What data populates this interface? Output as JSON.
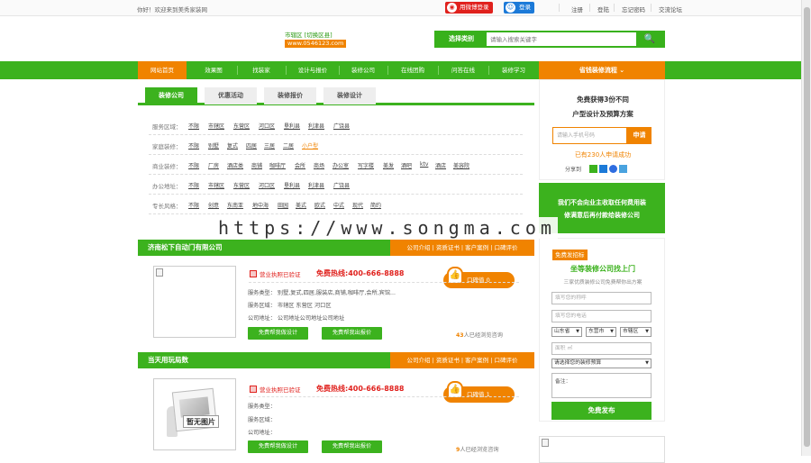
{
  "topbar": {
    "welcome": "你好！欢迎来到美秀家装网",
    "weibo_login": "用微博登录",
    "qq_login": "登录",
    "links": [
      "注册",
      "登陆",
      "忘记密码",
      "交流论坛"
    ]
  },
  "header": {
    "city": "市辖区 [切换区县]",
    "phone": "www.0546123.com",
    "search_category": "选择类别",
    "search_placeholder": "请输入搜索关键字"
  },
  "nav": {
    "items": [
      "网站首页",
      "效果图",
      "找装家",
      "设计与报价",
      "装修公司",
      "在线团购",
      "问答在线",
      "装修学习"
    ],
    "right": "省钱装修流程 ⌄"
  },
  "tabs": [
    "装修公司",
    "优惠活动",
    "装修报价",
    "装修设计"
  ],
  "filters": [
    {
      "label": "服务区域：",
      "options": [
        "不限",
        "市辖区",
        "东营区",
        "河口区",
        "垦利县",
        "利津县",
        "广饶县"
      ]
    },
    {
      "label": "家庭装修：",
      "options": [
        "不限",
        "别墅",
        "复式",
        "四居",
        "三居",
        "二居",
        "小户型"
      ]
    },
    {
      "label": "商业装修：",
      "options": [
        "不限",
        "厂房",
        "酒店类",
        "商铺",
        "咖啡厅",
        "会所",
        "商场",
        "办公室",
        "写字楼",
        "美发",
        "酒吧",
        "ktv",
        "酒店",
        "美容院"
      ]
    },
    {
      "label": "办公地址：",
      "options": [
        "不限",
        "市辖区",
        "东营区",
        "河口区",
        "垦利县",
        "利津县",
        "广饶县"
      ]
    },
    {
      "label": "专长风格：",
      "options": [
        "不限",
        "创意",
        "东南亚",
        "地中海",
        "田园",
        "美式",
        "欧式",
        "中式",
        "现代",
        "简约"
      ]
    }
  ],
  "watermark": "https://www.songma.com",
  "companies": [
    {
      "name": "济南松下自动门有限公司",
      "links": "公司介绍 | 资质证书 | 客户案例 | 口碑评价",
      "license": "营业执照已验证",
      "hotline": "免费热线:400-666-8888",
      "koubei": "口碑值 0",
      "type": "服务类型：  别墅,复式,四居,服装店,商铺,咖啡厅,会所,宾馆...",
      "area": "服务区域：  市辖区 东营区 河口区",
      "address": "公司地址：  公司地址公司地址公司地址",
      "btn_design": "免费帮我做设计",
      "btn_quote": "免费帮我出报价",
      "visits_num": "43",
      "visits_text": "人已经浏览咨询"
    },
    {
      "name": "当天用玩局数",
      "links": "公司介绍 | 资质证书 | 客户案例 | 口碑评价",
      "license": "营业执照已验证",
      "hotline": "免费热线:400-666-8888",
      "koubei": "口碑值 1",
      "no_image": "暂无图片",
      "type": "服务类型：",
      "area": "服务区域：",
      "address": "公司地址：",
      "btn_design": "免费帮我做设计",
      "btn_quote": "免费帮我出报价",
      "visits_num": "9",
      "visits_text": "人已经浏览咨询"
    }
  ],
  "sidebar": {
    "title1": "免费获得3份不同",
    "title2": "户型设计及预算方案",
    "phone_placeholder": "请输入手机号码",
    "apply": "申请",
    "count": "已有230人申请成功",
    "share": "分享到",
    "green_line1": "我们不会向业主收取任何费用装",
    "green_line2": "修满意后再付款给装修公司",
    "free_tag": "免费发招标",
    "form_title": "坐等装修公司找上门",
    "form_sub": "三家优质装修公司免费帮你出方案",
    "name_placeholder": "填写您的称呼",
    "phone2_placeholder": "填写您的电话",
    "province": "山东省",
    "city": "东营市",
    "district": "市辖区",
    "area_placeholder": "面积 ㎡",
    "budget": "请选择您的装修预算",
    "remark": "备注：",
    "submit": "免费发布"
  }
}
